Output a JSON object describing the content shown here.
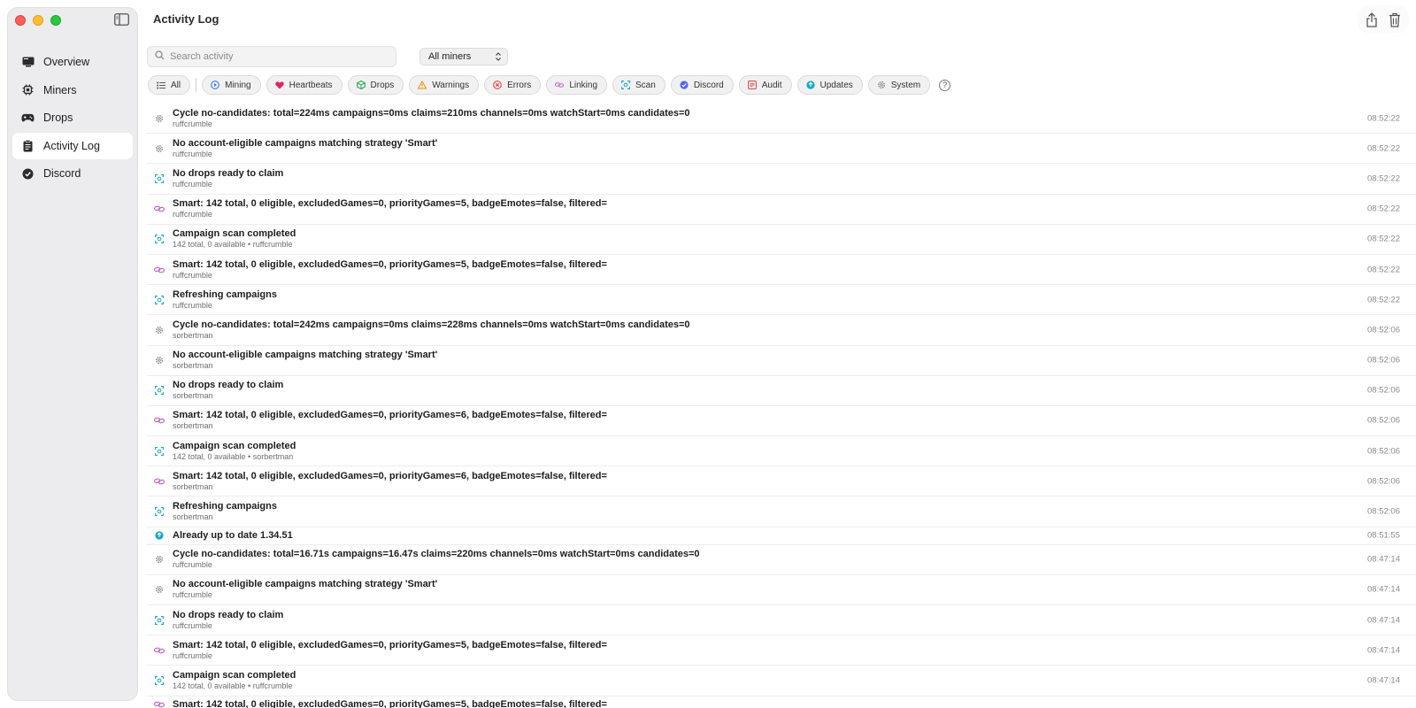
{
  "window": {
    "title": "Activity Log"
  },
  "sidebar": {
    "items": [
      {
        "label": "Overview",
        "icon": "monitor-icon",
        "active": false
      },
      {
        "label": "Miners",
        "icon": "chip-icon",
        "active": false
      },
      {
        "label": "Drops",
        "icon": "gamepad-icon",
        "active": false
      },
      {
        "label": "Activity Log",
        "icon": "clipboard-icon",
        "active": true
      },
      {
        "label": "Discord",
        "icon": "discord-icon",
        "active": false
      }
    ]
  },
  "search": {
    "placeholder": "Search activity"
  },
  "miner_select": {
    "value": "All miners"
  },
  "filters": [
    {
      "label": "All",
      "icon": "list-icon",
      "color": "#555555"
    },
    {
      "label": "Mining",
      "icon": "mining-icon",
      "color": "#2f7fe0"
    },
    {
      "label": "Heartbeats",
      "icon": "heart-icon",
      "color": "#e0245e"
    },
    {
      "label": "Drops",
      "icon": "cube-icon",
      "color": "#2ea44f"
    },
    {
      "label": "Warnings",
      "icon": "warning-icon",
      "color": "#f08c00"
    },
    {
      "label": "Errors",
      "icon": "error-icon",
      "color": "#e0443e"
    },
    {
      "label": "Linking",
      "icon": "link-icon",
      "color": "#c05ec9"
    },
    {
      "label": "Scan",
      "icon": "scan-icon",
      "color": "#17a8c4"
    },
    {
      "label": "Discord",
      "icon": "discord-icon",
      "color": "#5865f2"
    },
    {
      "label": "Audit",
      "icon": "audit-icon",
      "color": "#d9534f"
    },
    {
      "label": "Updates",
      "icon": "update-icon",
      "color": "#17a8c4"
    },
    {
      "label": "System",
      "icon": "gear-icon",
      "color": "#8e8e93"
    }
  ],
  "log": [
    {
      "type": "system",
      "message": "Cycle no-candidates: total=224ms campaigns=0ms claims=210ms channels=0ms watchStart=0ms candidates=0",
      "sub": "ruffcrumble",
      "time": "08:52:22"
    },
    {
      "type": "system",
      "message": "No account-eligible campaigns matching strategy 'Smart'",
      "sub": "ruffcrumble",
      "time": "08:52:22"
    },
    {
      "type": "scan",
      "message": "No drops ready to claim",
      "sub": "ruffcrumble",
      "time": "08:52:22"
    },
    {
      "type": "linking",
      "message": "Smart: 142 total, 0 eligible, excludedGames=0, priorityGames=5, badgeEmotes=false, filtered=",
      "sub": "ruffcrumble",
      "time": "08:52:22"
    },
    {
      "type": "scan",
      "message": "Campaign scan completed",
      "sub": "142 total, 0 available • ruffcrumble",
      "time": "08:52:22"
    },
    {
      "type": "linking",
      "message": "Smart: 142 total, 0 eligible, excludedGames=0, priorityGames=5, badgeEmotes=false, filtered=",
      "sub": "ruffcrumble",
      "time": "08:52:22"
    },
    {
      "type": "scan",
      "message": "Refreshing campaigns",
      "sub": "ruffcrumble",
      "time": "08:52:22"
    },
    {
      "type": "system",
      "message": "Cycle no-candidates: total=242ms campaigns=0ms claims=228ms channels=0ms watchStart=0ms candidates=0",
      "sub": "sorbertman",
      "time": "08:52:06"
    },
    {
      "type": "system",
      "message": "No account-eligible campaigns matching strategy 'Smart'",
      "sub": "sorbertman",
      "time": "08:52:06"
    },
    {
      "type": "scan",
      "message": "No drops ready to claim",
      "sub": "sorbertman",
      "time": "08:52:06"
    },
    {
      "type": "linking",
      "message": "Smart: 142 total, 0 eligible, excludedGames=0, priorityGames=6, badgeEmotes=false, filtered=",
      "sub": "sorbertman",
      "time": "08:52:06"
    },
    {
      "type": "scan",
      "message": "Campaign scan completed",
      "sub": "142 total, 0 available • sorbertman",
      "time": "08:52:06"
    },
    {
      "type": "linking",
      "message": "Smart: 142 total, 0 eligible, excludedGames=0, priorityGames=6, badgeEmotes=false, filtered=",
      "sub": "sorbertman",
      "time": "08:52:06"
    },
    {
      "type": "scan",
      "message": "Refreshing campaigns",
      "sub": "sorbertman",
      "time": "08:52:06"
    },
    {
      "type": "update",
      "message": "Already up to date 1.34.51",
      "sub": "",
      "time": "08:51:55"
    },
    {
      "type": "system",
      "message": "Cycle no-candidates: total=16.71s campaigns=16.47s claims=220ms channels=0ms watchStart=0ms candidates=0",
      "sub": "ruffcrumble",
      "time": "08:47:14"
    },
    {
      "type": "system",
      "message": "No account-eligible campaigns matching strategy 'Smart'",
      "sub": "ruffcrumble",
      "time": "08:47:14"
    },
    {
      "type": "scan",
      "message": "No drops ready to claim",
      "sub": "ruffcrumble",
      "time": "08:47:14"
    },
    {
      "type": "linking",
      "message": "Smart: 142 total, 0 eligible, excludedGames=0, priorityGames=5, badgeEmotes=false, filtered=",
      "sub": "ruffcrumble",
      "time": "08:47:14"
    },
    {
      "type": "scan",
      "message": "Campaign scan completed",
      "sub": "142 total, 0 available • ruffcrumble",
      "time": "08:47:14"
    },
    {
      "type": "linking",
      "message": "Smart: 142 total, 0 eligible, excludedGames=0, priorityGames=5, badgeEmotes=false, filtered=",
      "sub": "",
      "time": ""
    }
  ]
}
